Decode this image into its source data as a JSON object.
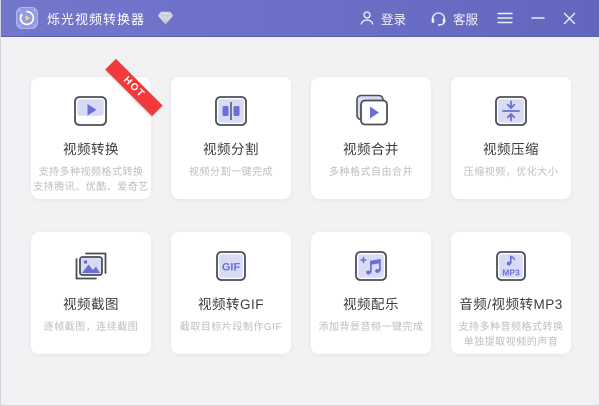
{
  "titlebar": {
    "app_title": "烁光视频转换器",
    "login_label": "登录",
    "service_label": "客服",
    "icons": {
      "app_logo": "app-logo-icon",
      "vip": "gem-icon",
      "login": "user-icon",
      "service": "headset-icon",
      "menu": "hamburger-menu-icon",
      "minimize": "minimize-icon",
      "close": "close-icon"
    }
  },
  "colors": {
    "titlebar_purple": "#6b6fc6",
    "accent_purple": "#6b6fd8",
    "icon_fill_lavender": "#d9dbf4",
    "icon_border_gray": "#4b4e56",
    "hot_red": "#f23a3d",
    "background_gray": "#f2f2f4",
    "card_white": "#ffffff",
    "title_text": "#3b3b42",
    "desc_text": "#bcbcc4"
  },
  "cards": [
    {
      "title": "视频转换",
      "desc1": "支持多种视频格式转换",
      "desc2": "支持腾讯、优酷、爱奇艺",
      "badge": "HOT",
      "icon": "video-convert-icon"
    },
    {
      "title": "视频分割",
      "desc1": "视频分割一键完成",
      "icon": "video-split-icon"
    },
    {
      "title": "视频合并",
      "desc1": "多种格式自由合并",
      "icon": "video-merge-icon"
    },
    {
      "title": "视频压缩",
      "desc1": "压缩视频，优化大小",
      "icon": "video-compress-icon"
    },
    {
      "title": "视频截图",
      "desc1": "逐帧截图，连续截图",
      "icon": "video-screenshot-icon"
    },
    {
      "title": "视频转GIF",
      "desc1": "截取目标片段制作GIF",
      "icon": "video-to-gif-icon"
    },
    {
      "title": "视频配乐",
      "desc1": "添加背景音频一键完成",
      "icon": "video-music-icon"
    },
    {
      "title": "音频/视频转MP3",
      "desc1": "支持多种音频格式转换",
      "desc2": "单独提取视频的声音",
      "icon": "audio-to-mp3-icon"
    }
  ]
}
